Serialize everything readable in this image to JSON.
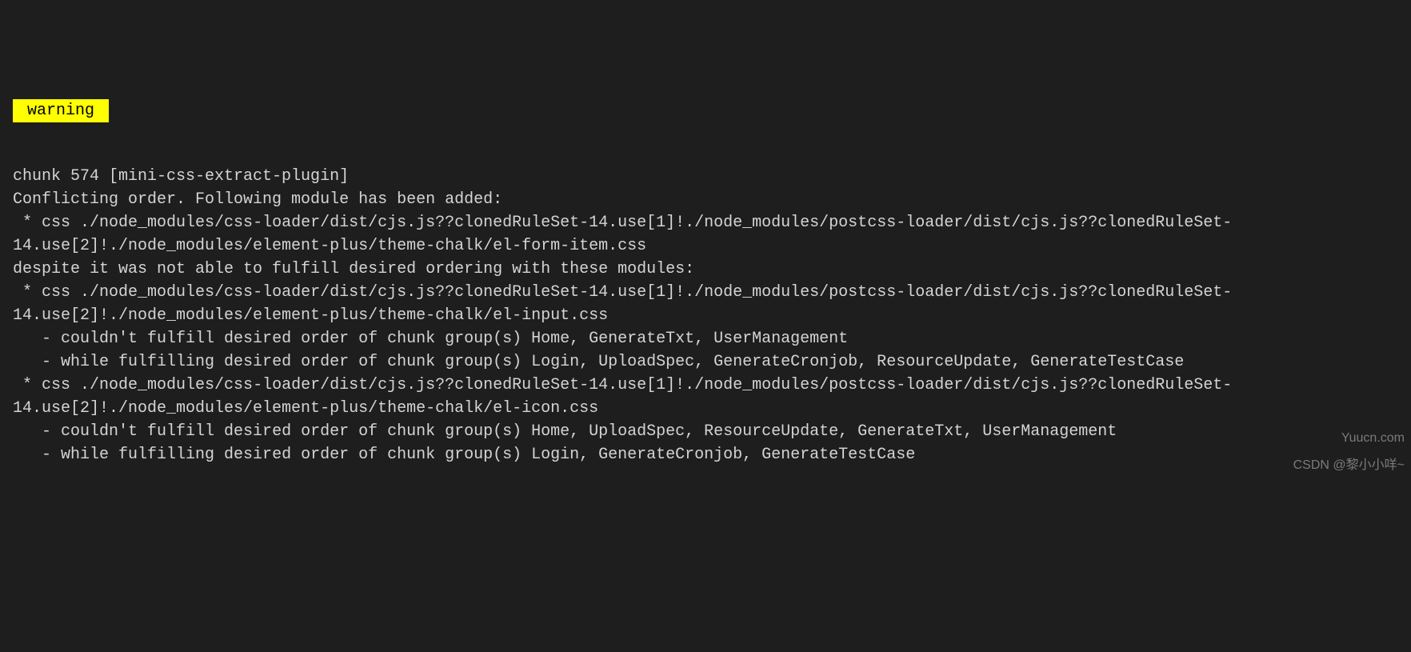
{
  "tag": {
    "label": "warning"
  },
  "terminal": {
    "lines": [
      "chunk 574 [mini-css-extract-plugin]",
      "Conflicting order. Following module has been added:",
      " * css ./node_modules/css-loader/dist/cjs.js??clonedRuleSet-14.use[1]!./node_modules/postcss-loader/dist/cjs.js??clonedRuleSet-14.use[2]!./node_modules/element-plus/theme-chalk/el-form-item.css",
      "despite it was not able to fulfill desired ordering with these modules:",
      " * css ./node_modules/css-loader/dist/cjs.js??clonedRuleSet-14.use[1]!./node_modules/postcss-loader/dist/cjs.js??clonedRuleSet-14.use[2]!./node_modules/element-plus/theme-chalk/el-input.css",
      "   - couldn't fulfill desired order of chunk group(s) Home, GenerateTxt, UserManagement",
      "   - while fulfilling desired order of chunk group(s) Login, UploadSpec, GenerateCronjob, ResourceUpdate, GenerateTestCase",
      " * css ./node_modules/css-loader/dist/cjs.js??clonedRuleSet-14.use[1]!./node_modules/postcss-loader/dist/cjs.js??clonedRuleSet-14.use[2]!./node_modules/element-plus/theme-chalk/el-icon.css",
      "   - couldn't fulfill desired order of chunk group(s) Home, UploadSpec, ResourceUpdate, GenerateTxt, UserManagement",
      "   - while fulfilling desired order of chunk group(s) Login, GenerateCronjob, GenerateTestCase"
    ]
  },
  "watermarks": {
    "right": "Yuucn.com",
    "bottom": "CSDN @黎小小咩~"
  }
}
